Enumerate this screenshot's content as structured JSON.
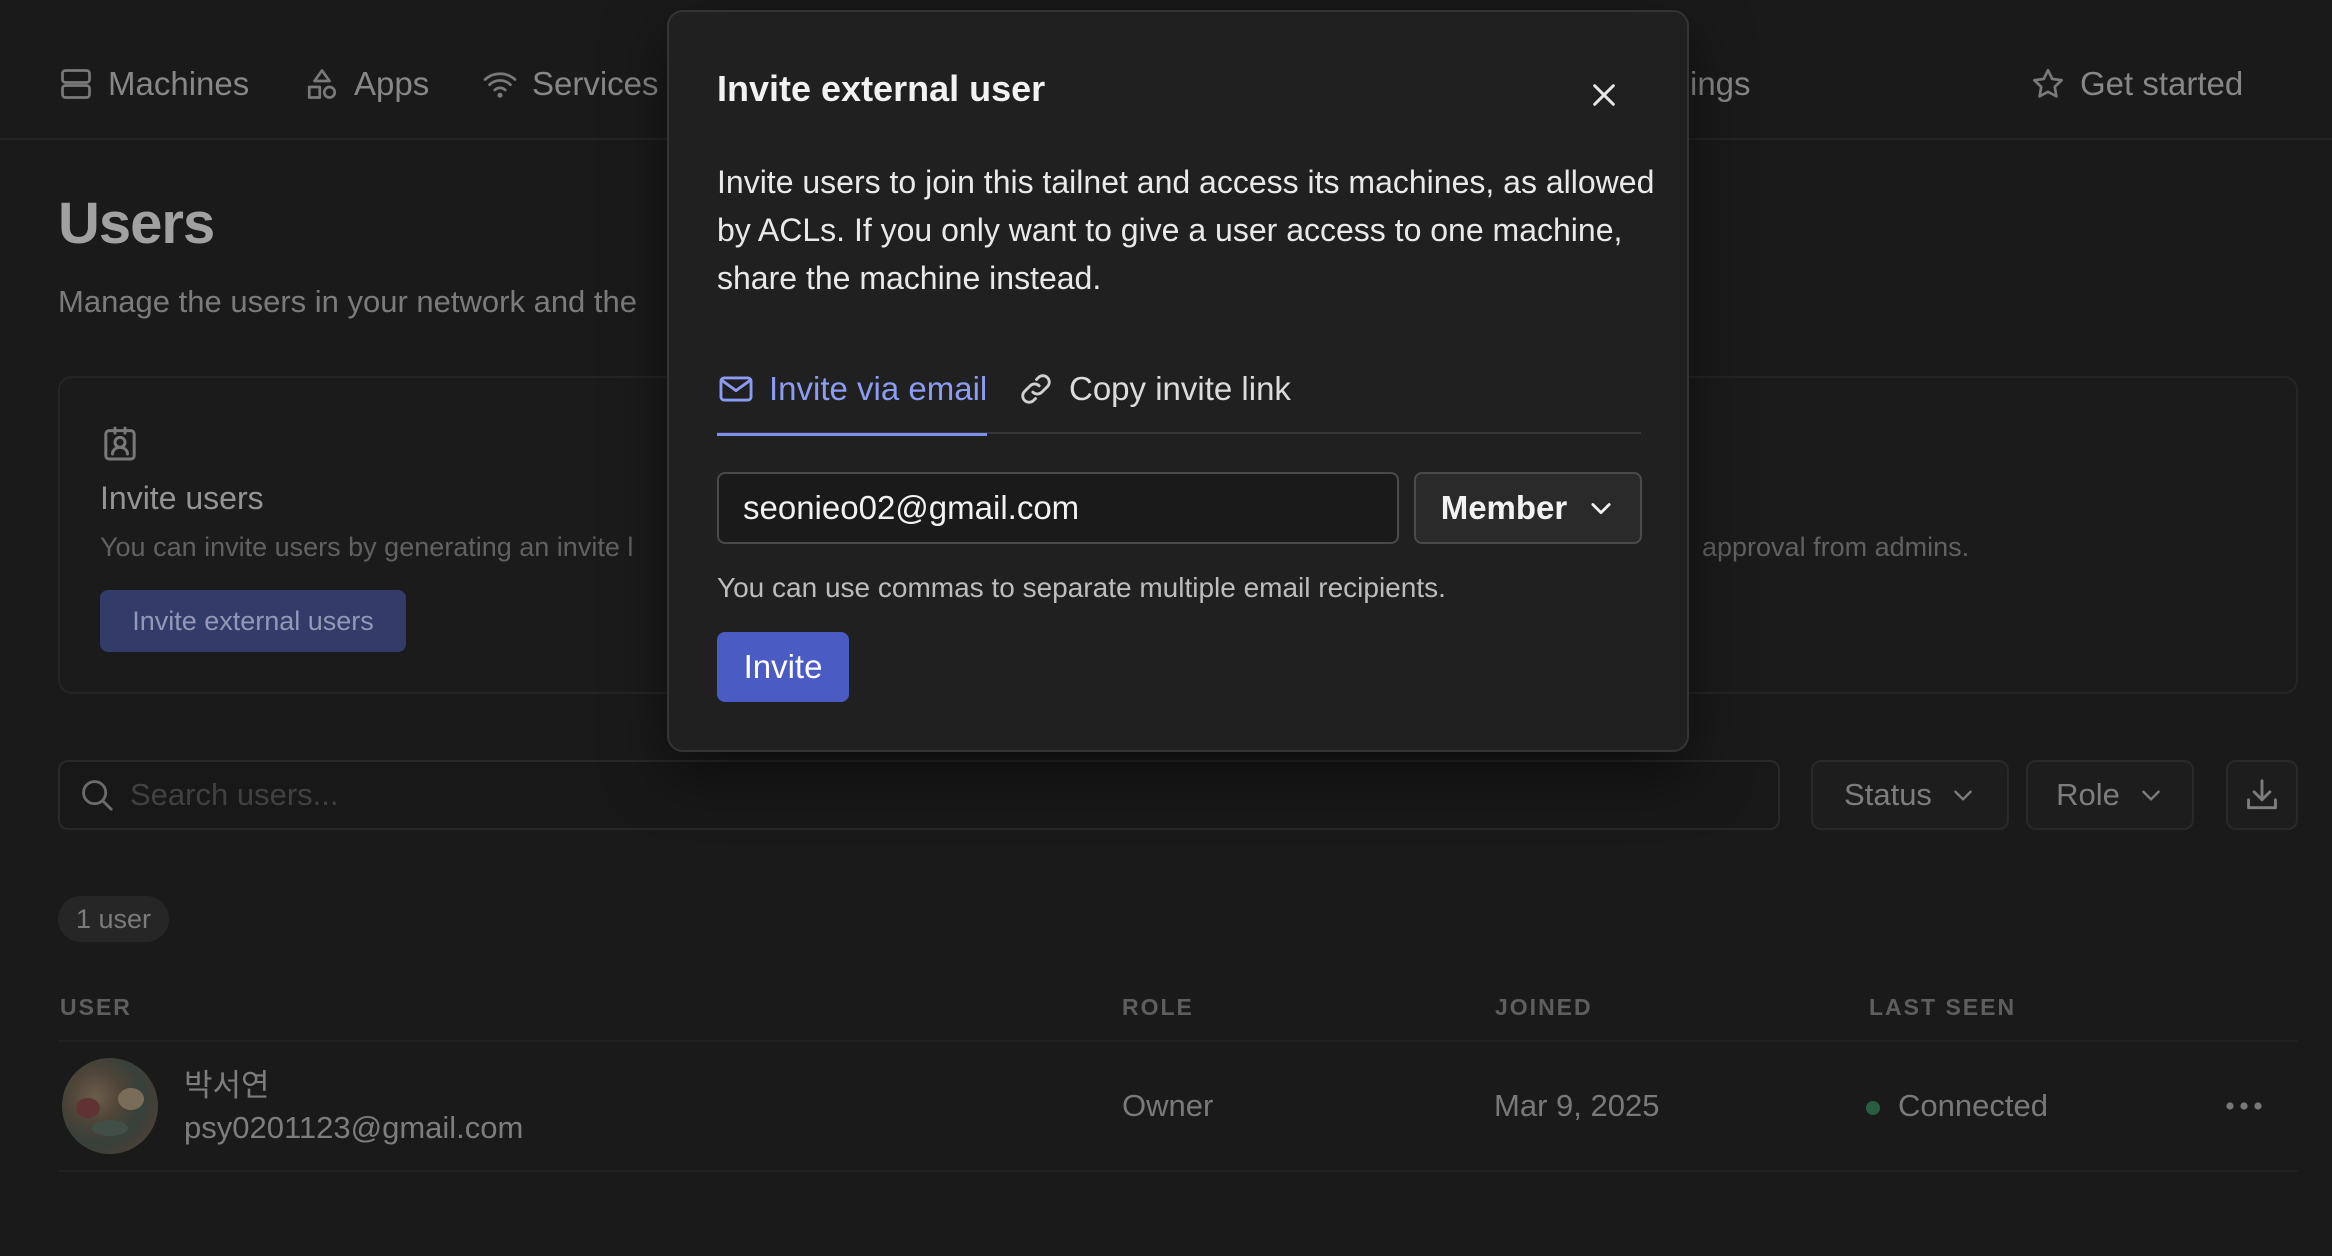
{
  "nav": {
    "machines": "Machines",
    "apps": "Apps",
    "services": "Services",
    "settings_partial": "ings",
    "get_started": "Get started"
  },
  "page": {
    "title": "Users",
    "subtitle": "Manage the users in your network and the"
  },
  "invite_card": {
    "title": "Invite users",
    "description": "You can invite users by generating an invite l",
    "description_right": "approval from admins.",
    "button_label": "Invite external users"
  },
  "search": {
    "placeholder": "Search users..."
  },
  "filters": {
    "status_label": "Status",
    "role_label": "Role"
  },
  "user_count": "1 user",
  "table": {
    "headers": {
      "user": "USER",
      "role": "ROLE",
      "joined": "JOINED",
      "last_seen": "LAST SEEN"
    },
    "rows": [
      {
        "name": "박서연",
        "email": "psy0201123@gmail.com",
        "role": "Owner",
        "joined": "Mar 9, 2025",
        "last_seen": "Connected"
      }
    ]
  },
  "modal": {
    "title": "Invite external user",
    "description": "Invite users to join this tailnet and access its machines, as allowed by ACLs. If you only want to give a user access to one machine, share the machine instead.",
    "tabs": {
      "email": "Invite via email",
      "link": "Copy invite link"
    },
    "email_value": "seonieo02@gmail.com",
    "role_value": "Member",
    "hint": "You can use commas to separate multiple email recipients.",
    "invite_button": "Invite"
  },
  "colors": {
    "background": "#1e1e1e",
    "modal_bg": "#202020",
    "accent": "#4a5bc4",
    "active_tab": "#8c9cf2",
    "connected_status": "#2f6a4b"
  }
}
